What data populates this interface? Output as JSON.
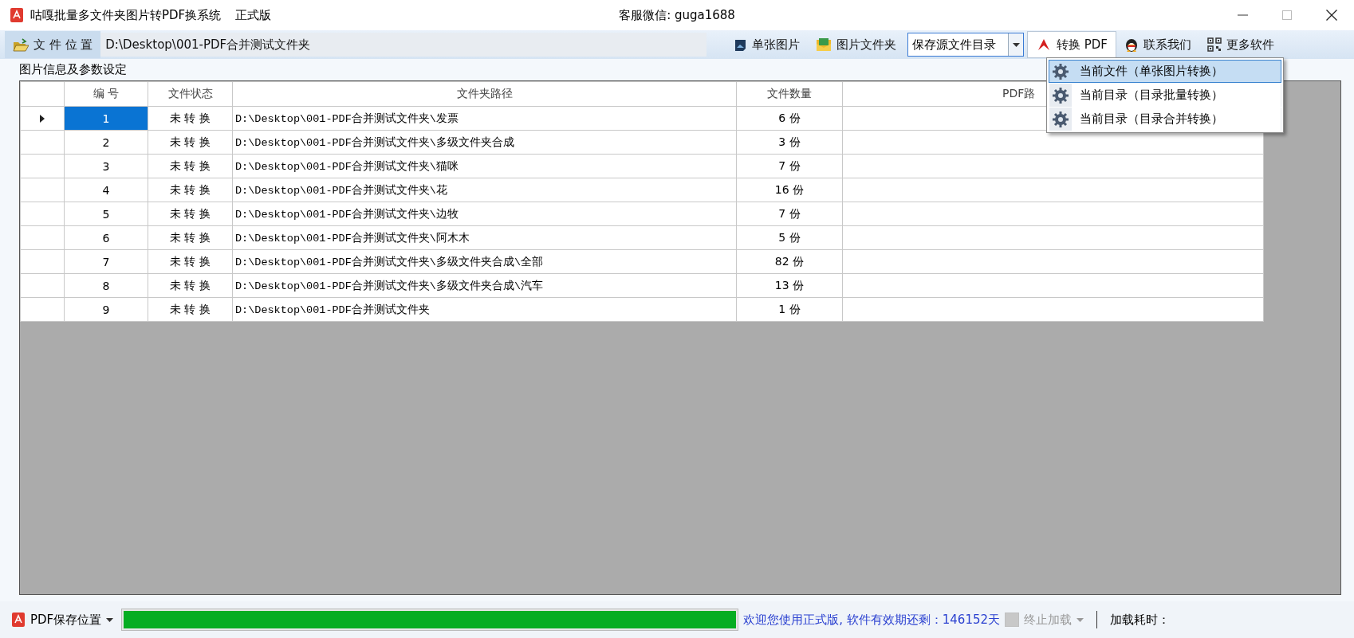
{
  "window": {
    "title": "咕嘎批量多文件夹图片转PDF换系统",
    "edition": "正式版",
    "contact": "客服微信: guga1688"
  },
  "toolbar": {
    "folder_button": "文 件 位 置",
    "folder_path": "D:\\Desktop\\001-PDF合并测试文件夹",
    "buttons": [
      {
        "label": "单张图片",
        "kind": "image"
      },
      {
        "label": "图片文件夹",
        "kind": "folder"
      }
    ],
    "save_mode": "保存源文件目录",
    "convert_button": {
      "label": "转换 PDF",
      "expanded": true
    },
    "extra_buttons": [
      {
        "label": "联系我们",
        "kind": "penguin"
      },
      {
        "label": "更多软件",
        "kind": "grid"
      }
    ]
  },
  "convert_menu": [
    {
      "label": "当前文件（单张图片转换）",
      "selected": true
    },
    {
      "label": "当前目录（目录批量转换）",
      "selected": false
    },
    {
      "label": "当前目录（目录合并转换）",
      "selected": false
    }
  ],
  "group_title": "图片信息及参数设定",
  "table": {
    "columns": [
      "编 号",
      "文件状态",
      "文件夹路径",
      "文件数量",
      "PDF路"
    ],
    "rows": [
      {
        "number": "1",
        "status": "未 转 换",
        "path": "D:\\Desktop\\001-PDF合并测试文件夹\\发票",
        "count": "6 份",
        "selected": true
      },
      {
        "number": "2",
        "status": "未 转 换",
        "path": "D:\\Desktop\\001-PDF合并测试文件夹\\多级文件夹合成",
        "count": "3 份",
        "selected": false
      },
      {
        "number": "3",
        "status": "未 转 换",
        "path": "D:\\Desktop\\001-PDF合并测试文件夹\\猫咪",
        "count": "7 份",
        "selected": false
      },
      {
        "number": "4",
        "status": "未 转 换",
        "path": "D:\\Desktop\\001-PDF合并测试文件夹\\花",
        "count": "16 份",
        "selected": false
      },
      {
        "number": "5",
        "status": "未 转 换",
        "path": "D:\\Desktop\\001-PDF合并测试文件夹\\边牧",
        "count": "7 份",
        "selected": false
      },
      {
        "number": "6",
        "status": "未 转 换",
        "path": "D:\\Desktop\\001-PDF合并测试文件夹\\阿木木",
        "count": "5 份",
        "selected": false
      },
      {
        "number": "7",
        "status": "未 转 换",
        "path": "D:\\Desktop\\001-PDF合并测试文件夹\\多级文件夹合成\\全部",
        "count": "82 份",
        "selected": false
      },
      {
        "number": "8",
        "status": "未 转 换",
        "path": "D:\\Desktop\\001-PDF合并测试文件夹\\多级文件夹合成\\汽车",
        "count": "13 份",
        "selected": false
      },
      {
        "number": "9",
        "status": "未 转 换",
        "path": "D:\\Desktop\\001-PDF合并测试文件夹",
        "count": "1 份",
        "selected": false
      }
    ]
  },
  "status_bar": {
    "save_location": "PDF保存位置",
    "level": 1,
    "message": "欢迎您使用正式版, 软件有效期还剩：146152天",
    "stop_loading": {
      "label": "终止加载",
      "checked": false,
      "disabled": true
    },
    "load_time": "加载耗时："
  }
}
